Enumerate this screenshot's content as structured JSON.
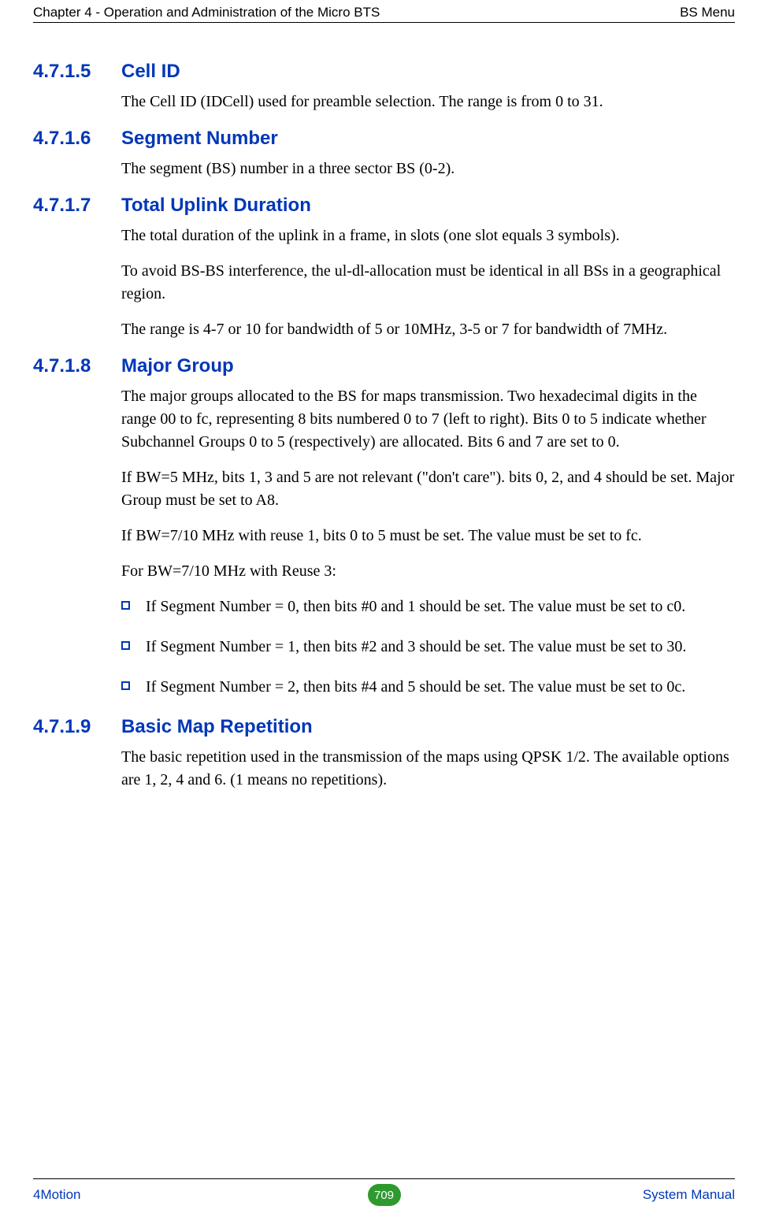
{
  "header": {
    "left": "Chapter 4 - Operation and Administration of the Micro BTS",
    "right": "BS Menu"
  },
  "sections": [
    {
      "num": "4.7.1.5",
      "title": "Cell ID",
      "paras": [
        "The Cell ID (IDCell) used for preamble selection. The range is from 0 to 31."
      ]
    },
    {
      "num": "4.7.1.6",
      "title": "Segment Number",
      "paras": [
        "The segment (BS) number in a three sector BS (0-2)."
      ]
    },
    {
      "num": "4.7.1.7",
      "title": "Total Uplink Duration",
      "paras": [
        "The total duration of the uplink in a frame, in slots (one slot equals 3 symbols).",
        "To avoid BS-BS interference, the ul-dl-allocation must be identical in all BSs in a geographical region.",
        "The range is 4-7 or 10 for bandwidth of 5 or 10MHz, 3-5 or 7 for bandwidth of 7MHz."
      ]
    },
    {
      "num": "4.7.1.8",
      "title": "Major Group",
      "paras": [
        "The major groups allocated to the BS for maps transmission. Two hexadecimal digits in the range 00 to fc, representing 8 bits numbered 0 to 7 (left to right). Bits 0 to 5 indicate whether Subchannel Groups 0 to 5 (respectively) are allocated. Bits 6 and 7 are set to 0.",
        "If BW=5 MHz, bits 1, 3 and 5 are not relevant (\"don't care\"). bits 0, 2, and 4 should be set. Major Group must be set to A8.",
        "If BW=7/10 MHz with reuse 1, bits 0 to 5 must be set. The value must be set to fc.",
        "For BW=7/10 MHz with Reuse 3:"
      ],
      "bullets": [
        "If Segment Number = 0, then bits #0 and 1 should be set. The value must be set to c0.",
        "If Segment Number = 1, then bits #2 and 3 should be set. The value must be set to 30.",
        "If Segment Number = 2, then bits #4 and 5 should be set. The value must be set to 0c."
      ]
    },
    {
      "num": "4.7.1.9",
      "title": "Basic Map Repetition",
      "paras": [
        "The basic repetition used in the transmission of the maps using QPSK 1/2. The available options are 1, 2, 4 and 6. (1 means no repetitions)."
      ]
    }
  ],
  "footer": {
    "left": "4Motion",
    "page": "709",
    "right": "System Manual"
  }
}
